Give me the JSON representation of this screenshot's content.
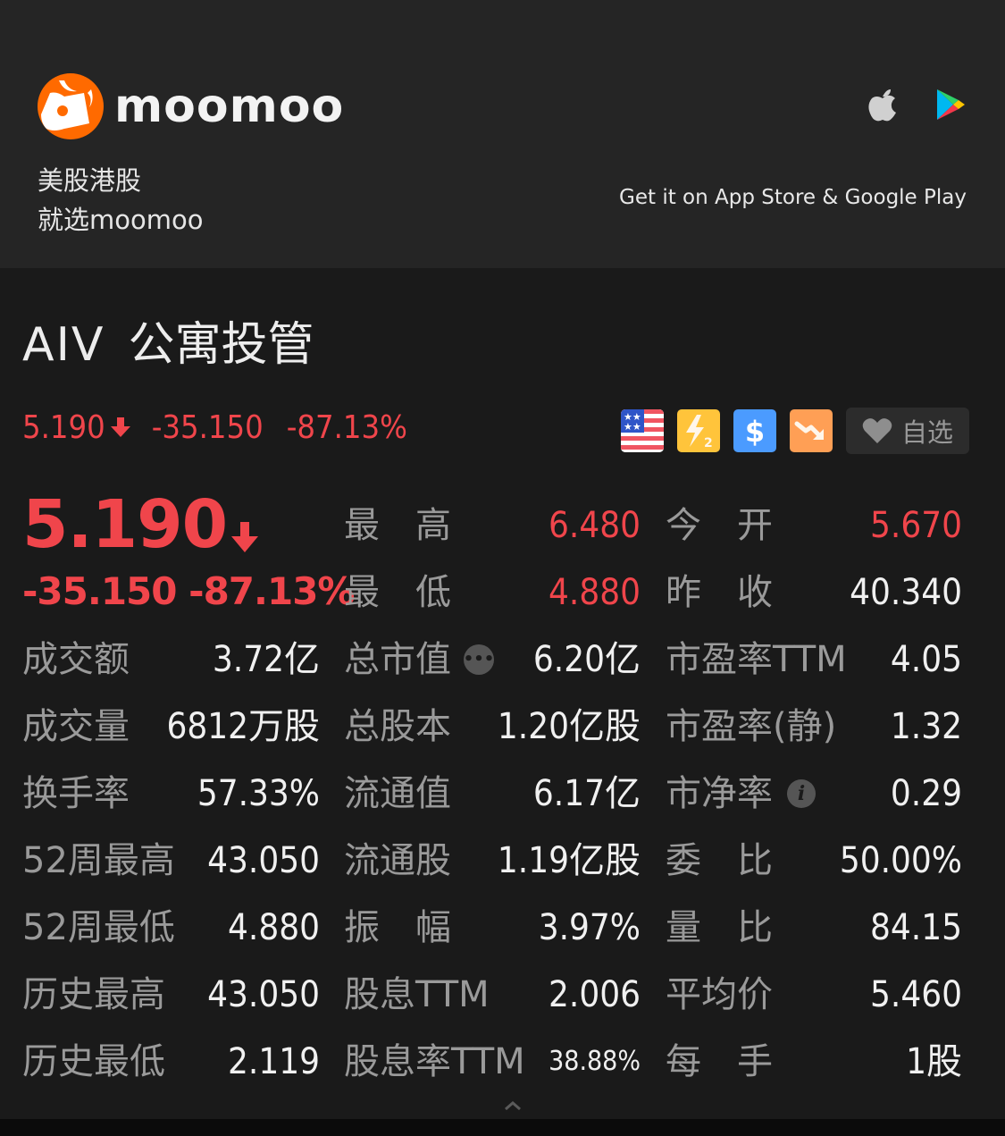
{
  "banner": {
    "brand": "moomoo",
    "slogan_line1": "美股港股",
    "slogan_line2": "就选moomoo",
    "store_text": "Get it on App Store & Google Play",
    "icons": [
      "apple-icon",
      "google-play-icon"
    ],
    "brand_color": "#ff6a00"
  },
  "stock": {
    "code": "AIV",
    "name": "公寓投管",
    "price": "5.190",
    "change": "-35.150",
    "change_pct": "-87.13%",
    "direction": "down",
    "down_color": "#f0454b",
    "tags": [
      "us-flag-icon",
      "lightning-level2-icon",
      "dollar-icon",
      "downtrend-icon"
    ],
    "watchlist_label": "自选"
  },
  "stats": {
    "col1": [
      {
        "label": "成交额",
        "value": "3.72亿"
      },
      {
        "label": "成交量",
        "value": "6812万股"
      },
      {
        "label": "换手率",
        "value": "57.33%"
      },
      {
        "label": "52周最高",
        "value": "43.050"
      },
      {
        "label": "52周最低",
        "value": "4.880"
      },
      {
        "label": "历史最高",
        "value": "43.050"
      },
      {
        "label": "历史最低",
        "value": "2.119"
      }
    ],
    "col2": [
      {
        "label": "最　高",
        "value": "6.480"
      },
      {
        "label": "最　低",
        "value": "4.880"
      },
      {
        "label": "总市值",
        "value": "6.20亿"
      },
      {
        "label": "总股本",
        "value": "1.20亿股"
      },
      {
        "label": "流通值",
        "value": "6.17亿"
      },
      {
        "label": "流通股",
        "value": "1.19亿股"
      },
      {
        "label": "振　幅",
        "value": "3.97%"
      },
      {
        "label": "股息TTM",
        "value": "2.006"
      },
      {
        "label": "股息率TTM",
        "value": "38.88%"
      }
    ],
    "col3": [
      {
        "label": "今　开",
        "value": "5.670"
      },
      {
        "label": "昨　收",
        "value": "40.340"
      },
      {
        "label": "市盈率TTM",
        "value": "4.05"
      },
      {
        "label": "市盈率(静)",
        "value": "1.32"
      },
      {
        "label": "市净率",
        "value": "0.29"
      },
      {
        "label": "委　比",
        "value": "50.00%"
      },
      {
        "label": "量　比",
        "value": "84.15"
      },
      {
        "label": "平均价",
        "value": "5.460"
      },
      {
        "label": "每　手",
        "value": "1股"
      }
    ]
  }
}
